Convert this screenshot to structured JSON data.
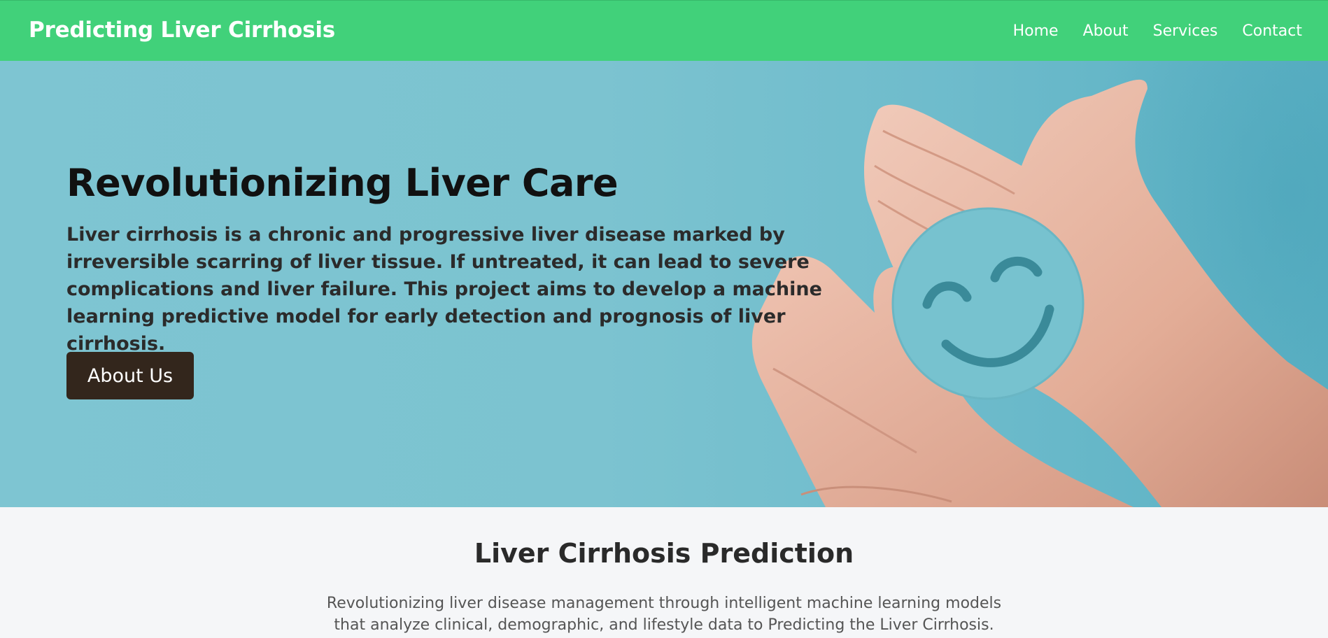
{
  "navbar": {
    "brand": "Predicting Liver Cirrhosis",
    "links": [
      "Home",
      "About",
      "Services",
      "Contact"
    ]
  },
  "hero": {
    "title": "Revolutionizing Liver Care",
    "text": "Liver cirrhosis is a chronic and progressive liver disease marked by irreversible scarring of liver tissue. If untreated, it can lead to severe complications and liver failure. This project aims to develop a machine learning predictive model for early detection and prognosis of liver cirrhosis.",
    "button_label": "About Us",
    "image_icon": "hands-holding-smiley-image"
  },
  "section": {
    "title": "Liver Cirrhosis Prediction",
    "text": "Revolutionizing liver disease management through intelligent machine learning models that analyze clinical, demographic, and lifestyle data to Predicting the Liver Cirrhosis."
  },
  "colors": {
    "navbar": "#41d17a",
    "hero_bg": "#7ec5d2",
    "button": "#33261c",
    "section_bg": "#f5f6f8"
  }
}
